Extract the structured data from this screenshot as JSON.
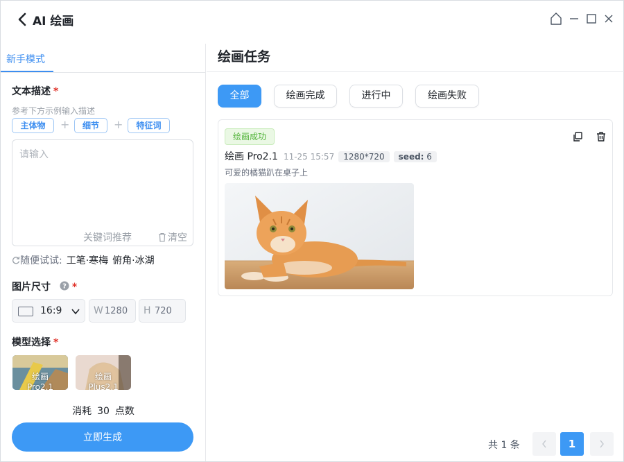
{
  "app": {
    "title": "AI 绘画"
  },
  "left": {
    "tab": "新手模式",
    "text_section": {
      "title": "文本描述",
      "required": "*",
      "hint": "参考下方示例输入描述",
      "chips": [
        "主体物",
        "细节",
        "特征词"
      ],
      "placeholder": "请输入",
      "value": "",
      "keyword_link": "关键词推荐",
      "clear_link": "清空"
    },
    "try_row": {
      "label": "随便试试:",
      "items": [
        "工笔·寒梅",
        "俯角·冰湖"
      ]
    },
    "size_section": {
      "title": "图片尺寸",
      "required": "*",
      "ratio": "16:9",
      "w_label": "W",
      "w_value": "1280",
      "h_label": "H",
      "h_value": "720"
    },
    "model_section": {
      "title": "模型选择",
      "required": "*",
      "models": [
        {
          "label": "绘画\nPro2.1",
          "selected": true
        },
        {
          "label": "绘画\nPlus2.1",
          "selected": false
        }
      ]
    },
    "cost": {
      "prefix": "消耗",
      "amount": "30",
      "suffix": "点数"
    },
    "generate_label": "立即生成"
  },
  "right": {
    "title": "绘画任务",
    "filters": [
      {
        "label": "全部",
        "active": true
      },
      {
        "label": "绘画完成",
        "active": false
      },
      {
        "label": "进行中",
        "active": false
      },
      {
        "label": "绘画失败",
        "active": false
      }
    ],
    "task": {
      "status": "绘画成功",
      "model": "绘画 Pro2.1",
      "time": "11-25 15:57",
      "resolution": "1280*720",
      "seed_label": "seed:",
      "seed_value": "6",
      "prompt": "可爱的橘猫趴在桌子上"
    },
    "pagination": {
      "total_text": "共 1 条",
      "current_page": "1"
    }
  },
  "colors": {
    "accent": "#3d99f5",
    "success": "#52b33a",
    "required": "#e0342b"
  },
  "icons": [
    "chevron-left-icon",
    "home-icon",
    "minimize-icon",
    "maximize-icon",
    "close-icon",
    "refresh-icon",
    "help-icon",
    "trash-icon",
    "copy-icon",
    "chevron-down-icon",
    "ratio-rect-icon",
    "chevron-right-icon"
  ]
}
